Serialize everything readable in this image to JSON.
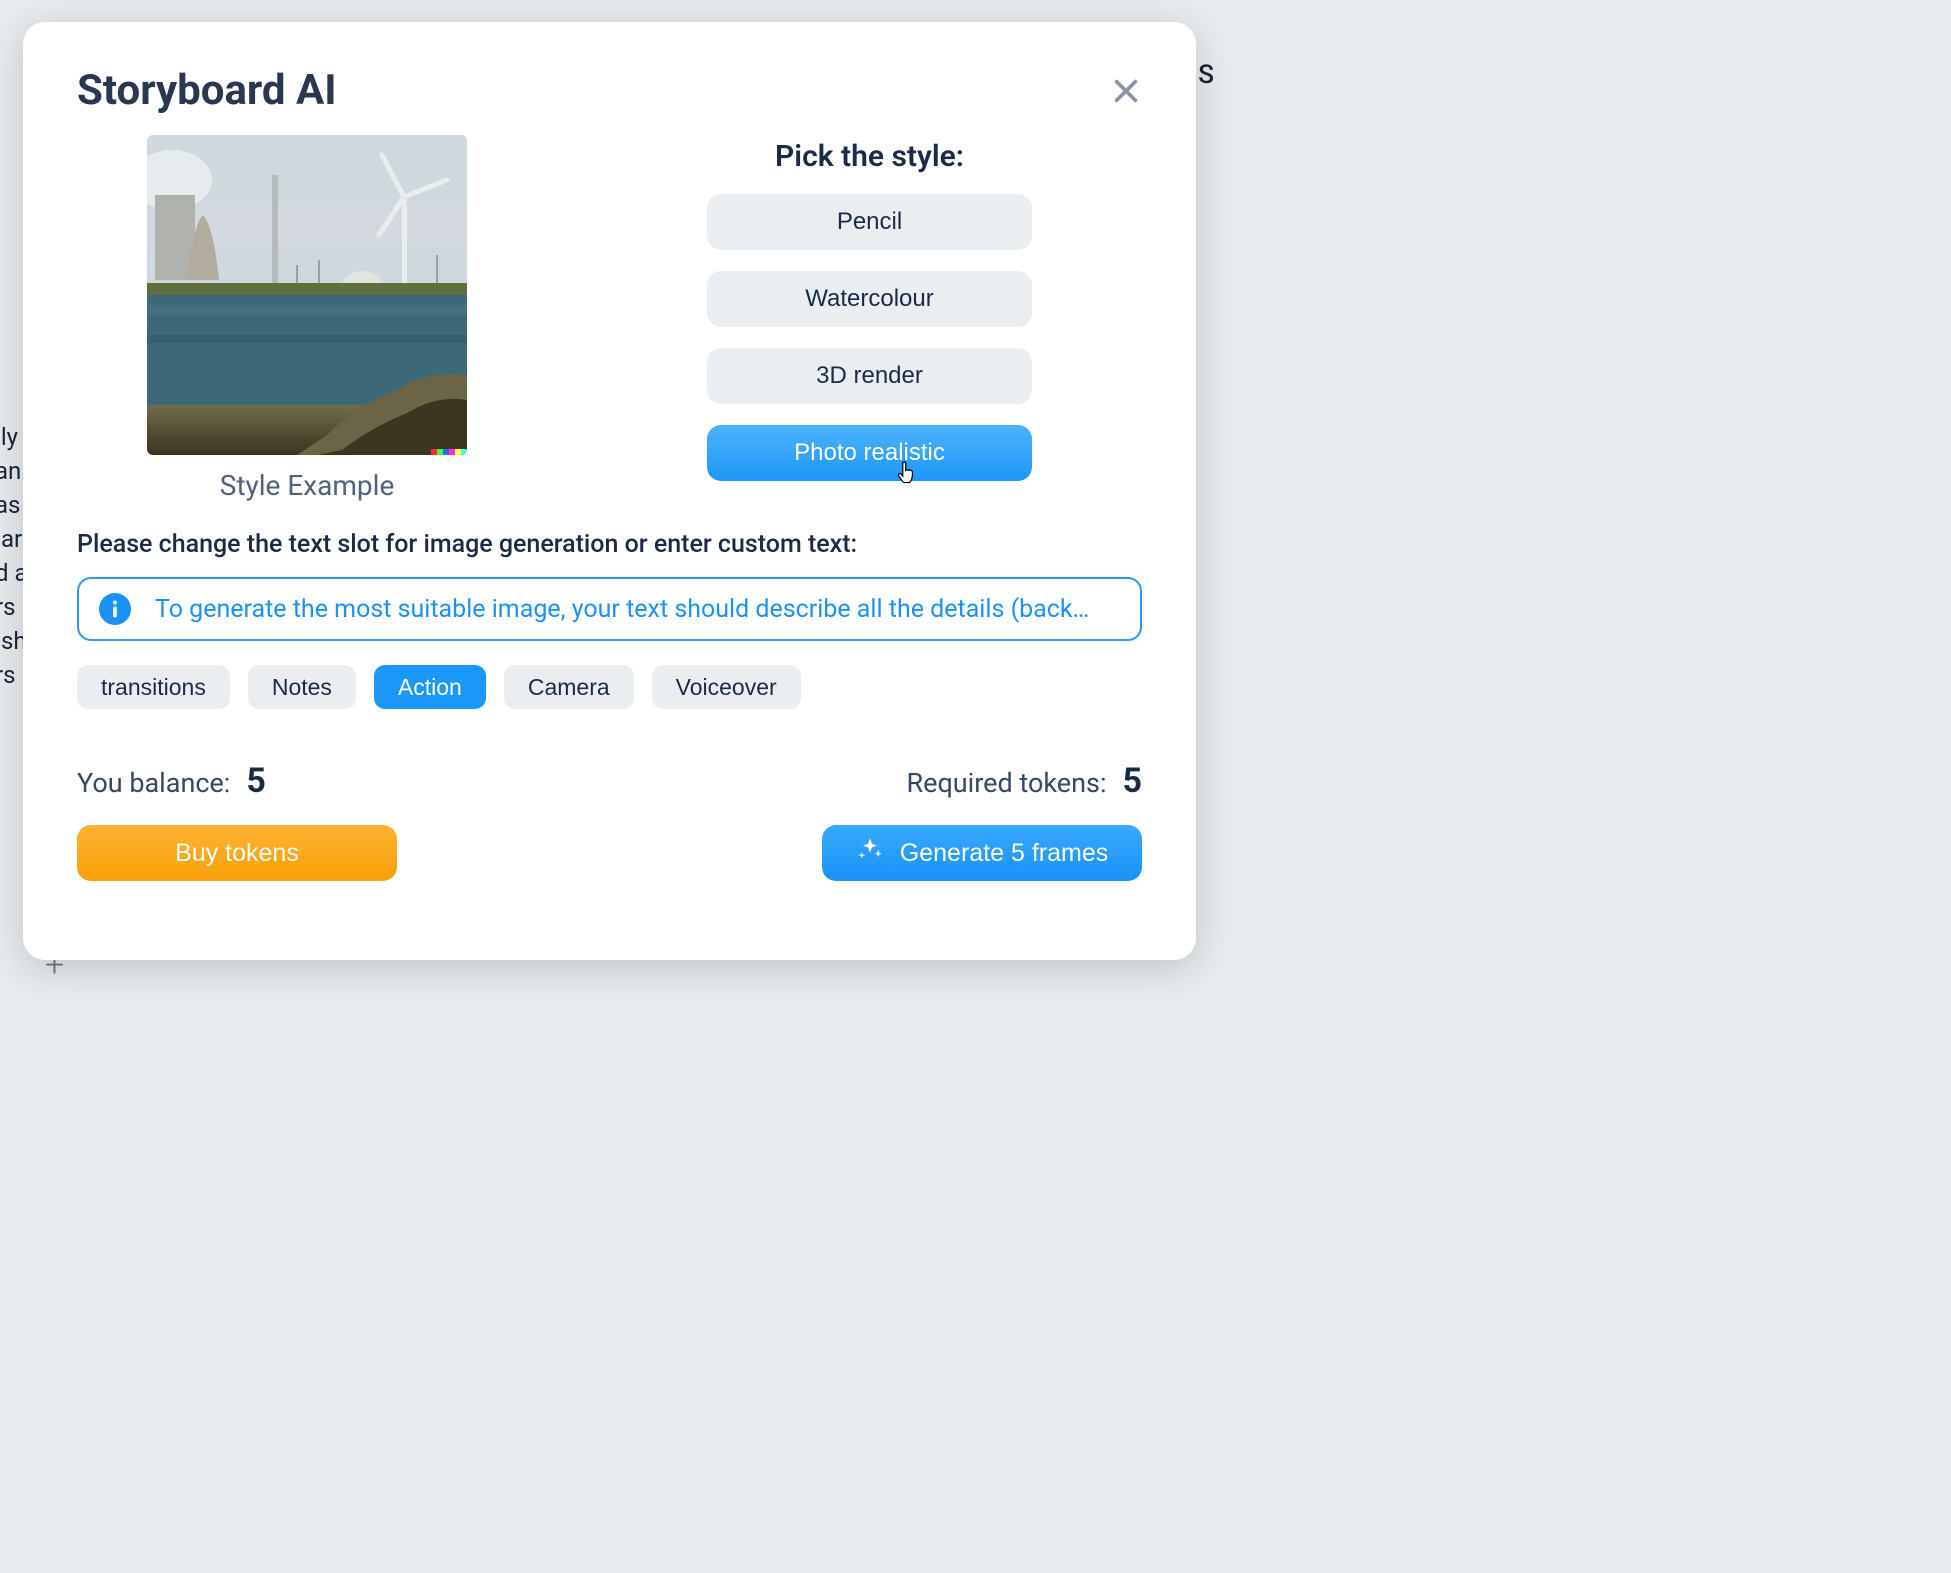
{
  "modal": {
    "title": "Storyboard AI",
    "example_caption": "Style Example",
    "style_heading": "Pick the style:",
    "styles": [
      {
        "label": "Pencil",
        "selected": false
      },
      {
        "label": "Watercolour",
        "selected": false
      },
      {
        "label": "3D render",
        "selected": false
      },
      {
        "label": "Photo realistic",
        "selected": true
      }
    ],
    "prompt_label": "Please change the text slot for image generation or enter custom text:",
    "info_text": "To generate the most suitable image, your text should describe all the details (back…",
    "tabs": [
      {
        "label": "transitions",
        "selected": false
      },
      {
        "label": "Notes",
        "selected": false
      },
      {
        "label": "Action",
        "selected": true
      },
      {
        "label": "Camera",
        "selected": false
      },
      {
        "label": "Voiceover",
        "selected": false
      }
    ],
    "balance_label": "You balance:",
    "balance_value": "5",
    "required_label": "Required tokens:",
    "required_value": "5",
    "buy_label": "Buy tokens",
    "generate_label": "Generate 5 frames"
  },
  "background": {
    "left_text": "ily\nan\nas\n ar\nd a\nrs\n sh\nrs",
    "right_letter": "S",
    "plus": "+"
  }
}
